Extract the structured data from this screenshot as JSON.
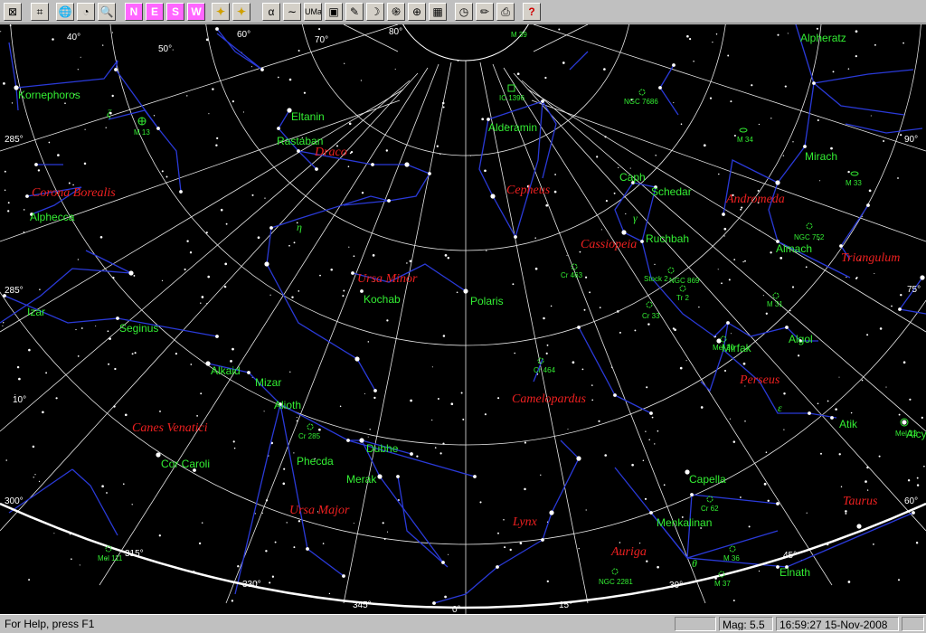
{
  "toolbar": [
    {
      "name": "zoom-fit-icon",
      "glyph": "⊠"
    },
    {
      "name": "zoom-frame-icon",
      "glyph": "⌗"
    },
    {
      "name": "globe-icon",
      "glyph": "🌐"
    },
    {
      "name": "compass-icon",
      "glyph": "◔"
    },
    {
      "name": "magnifier-icon",
      "glyph": "🔍"
    },
    {
      "name": "north-button",
      "glyph": "N"
    },
    {
      "name": "east-button",
      "glyph": "E"
    },
    {
      "name": "south-button",
      "glyph": "S"
    },
    {
      "name": "west-button",
      "glyph": "W"
    },
    {
      "name": "zenith-icon",
      "glyph": "✦"
    },
    {
      "name": "horizon-icon",
      "glyph": "✦"
    },
    {
      "name": "alpha-icon",
      "glyph": "α"
    },
    {
      "name": "constellation-lines-icon",
      "glyph": "∼"
    },
    {
      "name": "constellation-names-icon",
      "glyph": "UMa"
    },
    {
      "name": "boundaries-icon",
      "glyph": "▣"
    },
    {
      "name": "telescope-icon",
      "glyph": "✎"
    },
    {
      "name": "planet-icon",
      "glyph": "☽"
    },
    {
      "name": "galaxy-icon",
      "glyph": "֍"
    },
    {
      "name": "grid-globe-icon",
      "glyph": "⊕"
    },
    {
      "name": "grid-icon",
      "glyph": "▦"
    },
    {
      "name": "clock-icon",
      "glyph": "◷"
    },
    {
      "name": "pencil-icon",
      "glyph": "✏"
    },
    {
      "name": "print-icon",
      "glyph": "⎙"
    },
    {
      "name": "help-icon",
      "glyph": "?"
    }
  ],
  "status": {
    "help": "For Help, press F1",
    "mag": "Mag: 5.5",
    "datetime": "16:59:27 15-Nov-2008"
  },
  "sky": {
    "grid_labels": [
      "40°",
      "50°",
      "60°",
      "70°",
      "80°",
      "285°",
      "10°",
      "300°",
      "315°",
      "330°",
      "345°",
      "0°",
      "15°",
      "30°",
      "45°",
      "60°",
      "75°",
      "90°"
    ],
    "stars": [
      "Kornephoros",
      "Eltanin",
      "Rastaban",
      "Alphecca",
      "Izar",
      "Seginus",
      "Alkaid",
      "Mizar",
      "Alioth",
      "Cor Caroli",
      "Phecda",
      "Merak",
      "Dubhe",
      "Kochab",
      "Polaris",
      "Alderamin",
      "Caph",
      "Schedar",
      "Ruchbah",
      "Alpheratz",
      "Mirach",
      "Almach",
      "Algol",
      "Mirfak",
      "Atik",
      "Capella",
      "Menkalinan",
      "Elnath",
      "Alcyone"
    ],
    "constellations": [
      "Draco",
      "Corona Borealis",
      "Ursa Minor",
      "Canes Venatici",
      "Ursa Major",
      "Cepheus",
      "Cassiopeia",
      "Andromeda",
      "Triangulum",
      "Perseus",
      "Camelopardus",
      "Lynx",
      "Auriga",
      "Taurus"
    ],
    "objects": [
      "M 13",
      "M 39",
      "IC 1396",
      "NGC 7686",
      "M 34",
      "M 33",
      "NGC 752",
      "Cr 463",
      "Stock 2",
      "NGC 869",
      "Tr 2",
      "Cr 33",
      "M 31",
      "Mel 20",
      "Cr 464",
      "Cr 285",
      "Cr 62",
      "M 36",
      "M 37",
      "NGC 2281",
      "Mel 111",
      "Mel 22"
    ],
    "greek": [
      "ζ",
      "η",
      "γ",
      "ε",
      "θ"
    ]
  }
}
